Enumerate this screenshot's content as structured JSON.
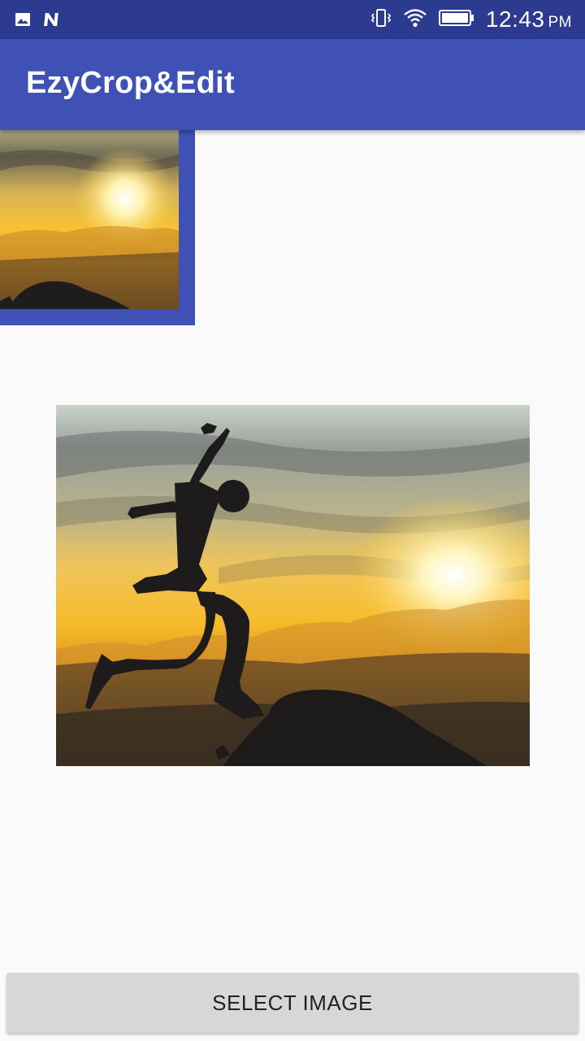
{
  "status_bar": {
    "time": "12:43",
    "ampm": "PM",
    "left_icons": [
      "image-notification-icon",
      "n-notification-icon"
    ],
    "right_icons": [
      "vibrate-icon",
      "wifi-icon",
      "battery-icon"
    ]
  },
  "app_bar": {
    "title": "EzyCrop&Edit",
    "color": "#3f51b5"
  },
  "thumbnail": {
    "frame_color": "#3f51b5",
    "image": "sunset-landscape-crop"
  },
  "main_image": {
    "image": "jumping-silhouette-sunset"
  },
  "button": {
    "label": "SELECT IMAGE"
  },
  "colors": {
    "status_bar": "#2c3a8f",
    "primary": "#3f51b5",
    "background": "#fafafa",
    "button": "#d6d7d7"
  }
}
